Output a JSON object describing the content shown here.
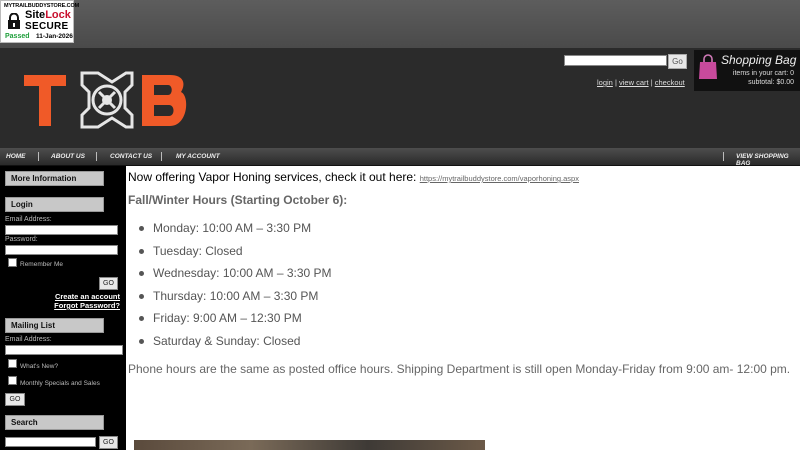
{
  "sitelock": {
    "url": "MYTRAILBUDDYSTORE.COM",
    "brand_site": "Site",
    "brand_lock": "Lock",
    "secure": "SECURE",
    "status": "Passed",
    "date": "11-Jan-2026"
  },
  "header": {
    "search_go": "Go",
    "links": [
      "login",
      "view cart",
      "checkout"
    ],
    "separator": "|"
  },
  "bag": {
    "title": "Shopping Bag",
    "count_text": "items in your cart: 0",
    "subtotal_text": "subtotal: $0.00"
  },
  "nav": {
    "items": [
      "HOME",
      "ABOUT US",
      "CONTACT US",
      "MY ACCOUNT"
    ],
    "right": "VIEW SHOPPING BAG"
  },
  "sidebar": {
    "more_info": "More Information",
    "login": {
      "title": "Login",
      "email_label": "Email Address:",
      "password_label": "Password:",
      "remember": "Remember Me",
      "go": "GO",
      "create": "Create an account",
      "forgot": "Forgot Password?"
    },
    "mailing": {
      "title": "Mailing List",
      "email_label": "Email Address:",
      "opt1": "What's New?",
      "opt2": "Monthly Specials and Sales",
      "go": "GO"
    },
    "search": {
      "title": "Search",
      "go": "GO"
    }
  },
  "main": {
    "intro": "Now offering Vapor Honing services, check it out here:",
    "intro_link": "https://mytrailbuddystore.com/vaporhoning.aspx",
    "hours_title": "Fall/Winter Hours (Starting October 6):",
    "hours": [
      "Monday: 10:00 AM – 3:30 PM",
      "Tuesday: Closed",
      "Wednesday: 10:00 AM – 3:30 PM",
      "Thursday: 10:00 AM – 3:30 PM",
      "Friday: 9:00 AM – 12:30 PM",
      "Saturday & Sunday: Closed"
    ],
    "phone_note": "Phone hours are the same as posted office hours. Shipping Department is still open Monday-Friday from 9:00 am- 12:00 pm."
  },
  "colors": {
    "logo_orange": "#f05a28",
    "header_bg": "#2b2b2b",
    "sidebar_bg": "#000000",
    "bag_accent": "#c84a9c"
  }
}
